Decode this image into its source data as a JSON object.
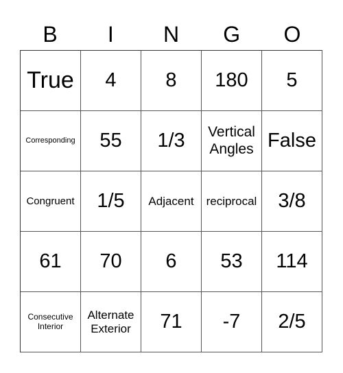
{
  "card": {
    "header": [
      "B",
      "I",
      "N",
      "G",
      "O"
    ],
    "rows": [
      [
        "True",
        "4",
        "8",
        "180",
        "5"
      ],
      [
        "Corresponding",
        "55",
        "1/3",
        "Vertical Angles",
        "False"
      ],
      [
        "Congruent",
        "1/5",
        "Adjacent",
        "reciprocal",
        "3/8"
      ],
      [
        "61",
        "70",
        "6",
        "53",
        "114"
      ],
      [
        "Consecutive Interior",
        "Alternate Exterior",
        "71",
        "-7",
        "2/5"
      ]
    ]
  }
}
